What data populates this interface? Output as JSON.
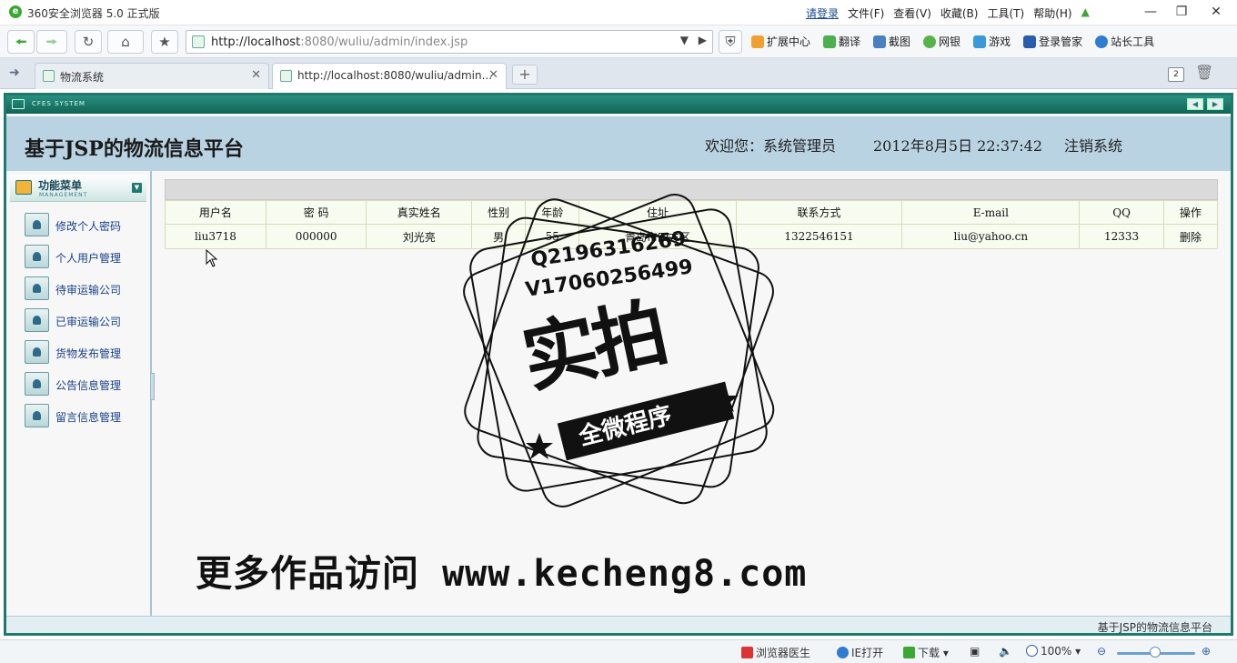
{
  "window": {
    "title": "360安全浏览器 5.0 正式版",
    "menu": [
      "请登录",
      "文件(F)",
      "查看(V)",
      "收藏(B)",
      "工具(T)",
      "帮助(H)"
    ],
    "controls": [
      "minimize",
      "restore",
      "close"
    ]
  },
  "toolbar": {
    "url_host": "http://localhost",
    "url_rest": ":8080/wuliu/admin/index.jsp",
    "tools": [
      "扩展中心",
      "翻译",
      "截图",
      "网银",
      "游戏",
      "登录管家",
      "站长工具"
    ]
  },
  "tabs": [
    {
      "label": "物流系统",
      "active": false
    },
    {
      "label": "http://localhost:8080/wuliu/admin...",
      "active": true
    }
  ],
  "tab_count": "2",
  "app": {
    "system_label": "CFES SYSTEM",
    "site_title": "基于JSP的物流信息平台",
    "welcome": "欢迎您：系统管理员",
    "datetime": "2012年8月5日  22:37:42",
    "logout": "注销系统",
    "footer": "基于JSP的物流信息平台"
  },
  "sidebar": {
    "title": "功能菜单",
    "subtitle": "MANAGEMENT",
    "items": [
      {
        "label": "修改个人密码"
      },
      {
        "label": "个人用户管理"
      },
      {
        "label": "待审运输公司"
      },
      {
        "label": "已审运输公司"
      },
      {
        "label": "货物发布管理"
      },
      {
        "label": "公告信息管理"
      },
      {
        "label": "留言信息管理"
      }
    ]
  },
  "table": {
    "headers": [
      "用户名",
      "密  码",
      "真实姓名",
      "性别",
      "年龄",
      "住址",
      "联系方式",
      "E-mail",
      "QQ",
      "操作"
    ],
    "rows": [
      [
        "liu3718",
        "000000",
        "刘光亮",
        "男",
        "55",
        "青岛市四方区",
        "1322546151",
        "liu@yahoo.cn",
        "12333",
        "删除"
      ]
    ]
  },
  "watermark": {
    "line1": "Q2196316269",
    "line2": "V17060256499",
    "big": "实拍",
    "ribbon": "全微程序",
    "bottom": "更多作品访问 www.kecheng8.com"
  },
  "statusbar": {
    "doctor": "浏览器医生",
    "ie_open": "IE打开",
    "download": "下载",
    "zoom": "100%"
  }
}
